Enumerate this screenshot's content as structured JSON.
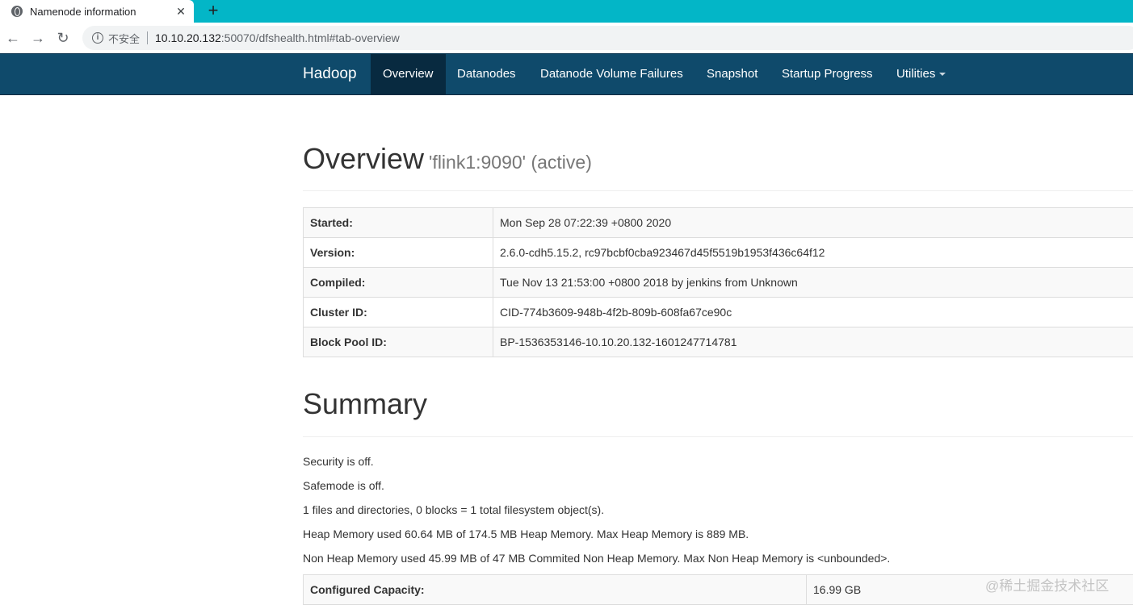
{
  "browser": {
    "tab_title": "Namenode information",
    "tab_close": "✕",
    "new_tab": "+",
    "back": "←",
    "forward": "→",
    "reload": "↻",
    "security_label": "不安全",
    "url_host": "10.10.20.132",
    "url_rest": ":50070/dfshealth.html#tab-overview"
  },
  "navbar": {
    "brand": "Hadoop",
    "items": [
      {
        "label": "Overview"
      },
      {
        "label": "Datanodes"
      },
      {
        "label": "Datanode Volume Failures"
      },
      {
        "label": "Snapshot"
      },
      {
        "label": "Startup Progress"
      },
      {
        "label": "Utilities"
      }
    ]
  },
  "overview": {
    "title": "Overview",
    "subtitle": "'flink1:9090' (active)",
    "rows": [
      {
        "key": "Started:",
        "value": "Mon Sep 28 07:22:39 +0800 2020"
      },
      {
        "key": "Version:",
        "value": "2.6.0-cdh5.15.2, rc97bcbf0cba923467d45f5519b1953f436c64f12"
      },
      {
        "key": "Compiled:",
        "value": "Tue Nov 13 21:53:00 +0800 2018 by jenkins from Unknown"
      },
      {
        "key": "Cluster ID:",
        "value": "CID-774b3609-948b-4f2b-809b-608fa67ce90c"
      },
      {
        "key": "Block Pool ID:",
        "value": "BP-1536353146-10.10.20.132-1601247714781"
      }
    ]
  },
  "summary": {
    "title": "Summary",
    "lines": [
      "Security is off.",
      "Safemode is off.",
      "1 files and directories, 0 blocks = 1 total filesystem object(s).",
      "Heap Memory used 60.64 MB of 174.5 MB Heap Memory. Max Heap Memory is 889 MB.",
      "Non Heap Memory used 45.99 MB of 47 MB Commited Non Heap Memory. Max Non Heap Memory is <unbounded>."
    ],
    "capacity": {
      "key": "Configured Capacity:",
      "value": "16.99 GB"
    }
  },
  "watermark": "@稀土掘金技术社区"
}
